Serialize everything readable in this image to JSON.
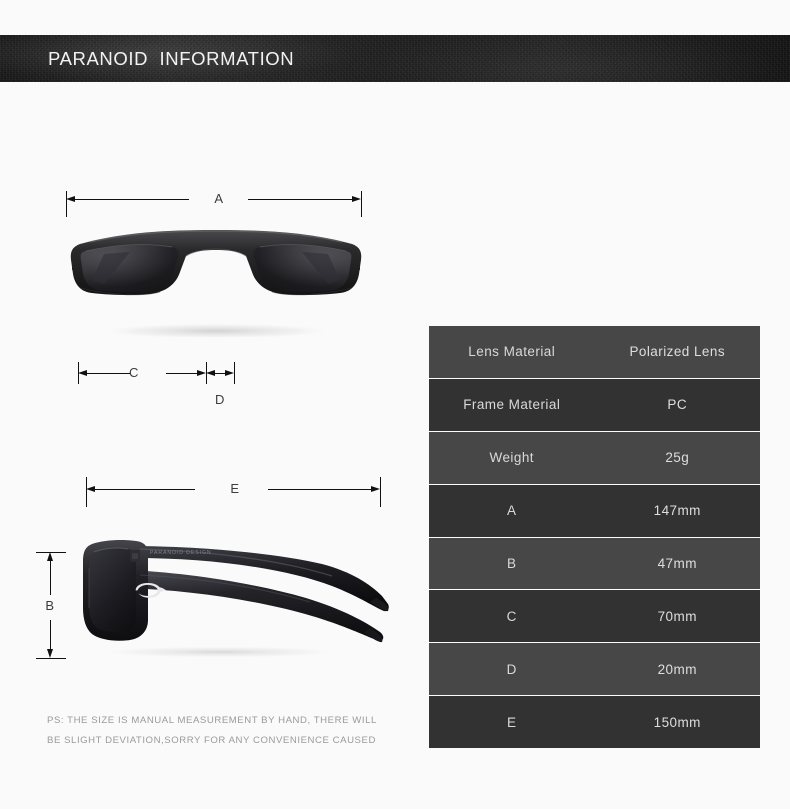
{
  "header": {
    "title": "PARANOID  INFORMATION"
  },
  "diagram": {
    "front_view_name": "sunglasses-front-view",
    "side_view_name": "sunglasses-side-view",
    "brand_engraving": "PARANOID DESIGN",
    "labels": {
      "a": "A",
      "b": "B",
      "c": "C",
      "d": "D",
      "e": "E"
    }
  },
  "spec_table": {
    "rows": [
      {
        "key": "Lens Material",
        "value": "Polarized Lens"
      },
      {
        "key": "Frame Material",
        "value": "PC"
      },
      {
        "key": "Weight",
        "value": "25g"
      },
      {
        "key": "A",
        "value": "147mm"
      },
      {
        "key": "B",
        "value": "47mm"
      },
      {
        "key": "C",
        "value": "70mm"
      },
      {
        "key": "D",
        "value": "20mm"
      },
      {
        "key": "E",
        "value": "150mm"
      }
    ]
  },
  "disclaimer": {
    "line1": "PS: THE SIZE IS MANUAL MEASUREMENT BY HAND, THERE WILL",
    "line2": "BE SLIGHT DEVIATION,SORRY FOR ANY CONVENIENCE CAUSED"
  },
  "colors": {
    "background": "#fafafa",
    "header_band": "#1d1d1d",
    "header_text": "#f2f2f2",
    "row_light": "#474747",
    "row_dark": "#323232",
    "row_text": "#d9d9d9",
    "dimension_line": "#111111",
    "disclaimer_text": "#9a9a9a"
  }
}
